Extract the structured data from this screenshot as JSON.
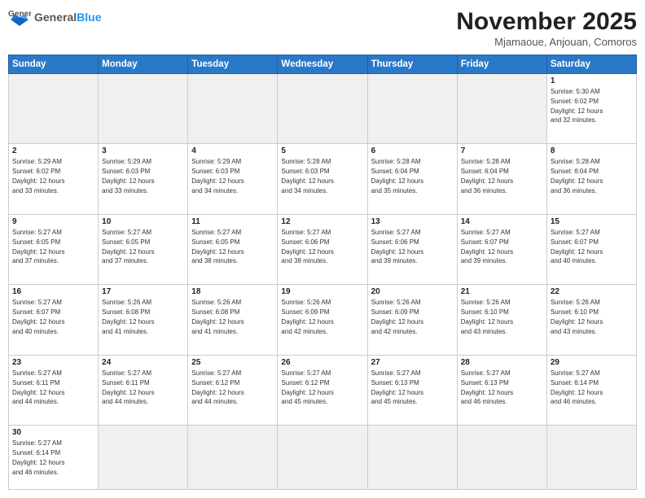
{
  "header": {
    "logo_general": "General",
    "logo_blue": "Blue",
    "month_title": "November 2025",
    "subtitle": "Mjamaoue, Anjouan, Comoros"
  },
  "weekdays": [
    "Sunday",
    "Monday",
    "Tuesday",
    "Wednesday",
    "Thursday",
    "Friday",
    "Saturday"
  ],
  "days": {
    "d1": {
      "num": "1",
      "info": "Sunrise: 5:30 AM\nSunset: 6:02 PM\nDaylight: 12 hours\nand 32 minutes."
    },
    "d2": {
      "num": "2",
      "info": "Sunrise: 5:29 AM\nSunset: 6:02 PM\nDaylight: 12 hours\nand 33 minutes."
    },
    "d3": {
      "num": "3",
      "info": "Sunrise: 5:29 AM\nSunset: 6:03 PM\nDaylight: 12 hours\nand 33 minutes."
    },
    "d4": {
      "num": "4",
      "info": "Sunrise: 5:29 AM\nSunset: 6:03 PM\nDaylight: 12 hours\nand 34 minutes."
    },
    "d5": {
      "num": "5",
      "info": "Sunrise: 5:28 AM\nSunset: 6:03 PM\nDaylight: 12 hours\nand 34 minutes."
    },
    "d6": {
      "num": "6",
      "info": "Sunrise: 5:28 AM\nSunset: 6:04 PM\nDaylight: 12 hours\nand 35 minutes."
    },
    "d7": {
      "num": "7",
      "info": "Sunrise: 5:28 AM\nSunset: 6:04 PM\nDaylight: 12 hours\nand 36 minutes."
    },
    "d8": {
      "num": "8",
      "info": "Sunrise: 5:28 AM\nSunset: 6:04 PM\nDaylight: 12 hours\nand 36 minutes."
    },
    "d9": {
      "num": "9",
      "info": "Sunrise: 5:27 AM\nSunset: 6:05 PM\nDaylight: 12 hours\nand 37 minutes."
    },
    "d10": {
      "num": "10",
      "info": "Sunrise: 5:27 AM\nSunset: 6:05 PM\nDaylight: 12 hours\nand 37 minutes."
    },
    "d11": {
      "num": "11",
      "info": "Sunrise: 5:27 AM\nSunset: 6:05 PM\nDaylight: 12 hours\nand 38 minutes."
    },
    "d12": {
      "num": "12",
      "info": "Sunrise: 5:27 AM\nSunset: 6:06 PM\nDaylight: 12 hours\nand 38 minutes."
    },
    "d13": {
      "num": "13",
      "info": "Sunrise: 5:27 AM\nSunset: 6:06 PM\nDaylight: 12 hours\nand 39 minutes."
    },
    "d14": {
      "num": "14",
      "info": "Sunrise: 5:27 AM\nSunset: 6:07 PM\nDaylight: 12 hours\nand 39 minutes."
    },
    "d15": {
      "num": "15",
      "info": "Sunrise: 5:27 AM\nSunset: 6:07 PM\nDaylight: 12 hours\nand 40 minutes."
    },
    "d16": {
      "num": "16",
      "info": "Sunrise: 5:27 AM\nSunset: 6:07 PM\nDaylight: 12 hours\nand 40 minutes."
    },
    "d17": {
      "num": "17",
      "info": "Sunrise: 5:26 AM\nSunset: 6:08 PM\nDaylight: 12 hours\nand 41 minutes."
    },
    "d18": {
      "num": "18",
      "info": "Sunrise: 5:26 AM\nSunset: 6:08 PM\nDaylight: 12 hours\nand 41 minutes."
    },
    "d19": {
      "num": "19",
      "info": "Sunrise: 5:26 AM\nSunset: 6:09 PM\nDaylight: 12 hours\nand 42 minutes."
    },
    "d20": {
      "num": "20",
      "info": "Sunrise: 5:26 AM\nSunset: 6:09 PM\nDaylight: 12 hours\nand 42 minutes."
    },
    "d21": {
      "num": "21",
      "info": "Sunrise: 5:26 AM\nSunset: 6:10 PM\nDaylight: 12 hours\nand 43 minutes."
    },
    "d22": {
      "num": "22",
      "info": "Sunrise: 5:26 AM\nSunset: 6:10 PM\nDaylight: 12 hours\nand 43 minutes."
    },
    "d23": {
      "num": "23",
      "info": "Sunrise: 5:27 AM\nSunset: 6:11 PM\nDaylight: 12 hours\nand 44 minutes."
    },
    "d24": {
      "num": "24",
      "info": "Sunrise: 5:27 AM\nSunset: 6:11 PM\nDaylight: 12 hours\nand 44 minutes."
    },
    "d25": {
      "num": "25",
      "info": "Sunrise: 5:27 AM\nSunset: 6:12 PM\nDaylight: 12 hours\nand 44 minutes."
    },
    "d26": {
      "num": "26",
      "info": "Sunrise: 5:27 AM\nSunset: 6:12 PM\nDaylight: 12 hours\nand 45 minutes."
    },
    "d27": {
      "num": "27",
      "info": "Sunrise: 5:27 AM\nSunset: 6:13 PM\nDaylight: 12 hours\nand 45 minutes."
    },
    "d28": {
      "num": "28",
      "info": "Sunrise: 5:27 AM\nSunset: 6:13 PM\nDaylight: 12 hours\nand 46 minutes."
    },
    "d29": {
      "num": "29",
      "info": "Sunrise: 5:27 AM\nSunset: 6:14 PM\nDaylight: 12 hours\nand 46 minutes."
    },
    "d30": {
      "num": "30",
      "info": "Sunrise: 5:27 AM\nSunset: 6:14 PM\nDaylight: 12 hours\nand 46 minutes."
    }
  }
}
